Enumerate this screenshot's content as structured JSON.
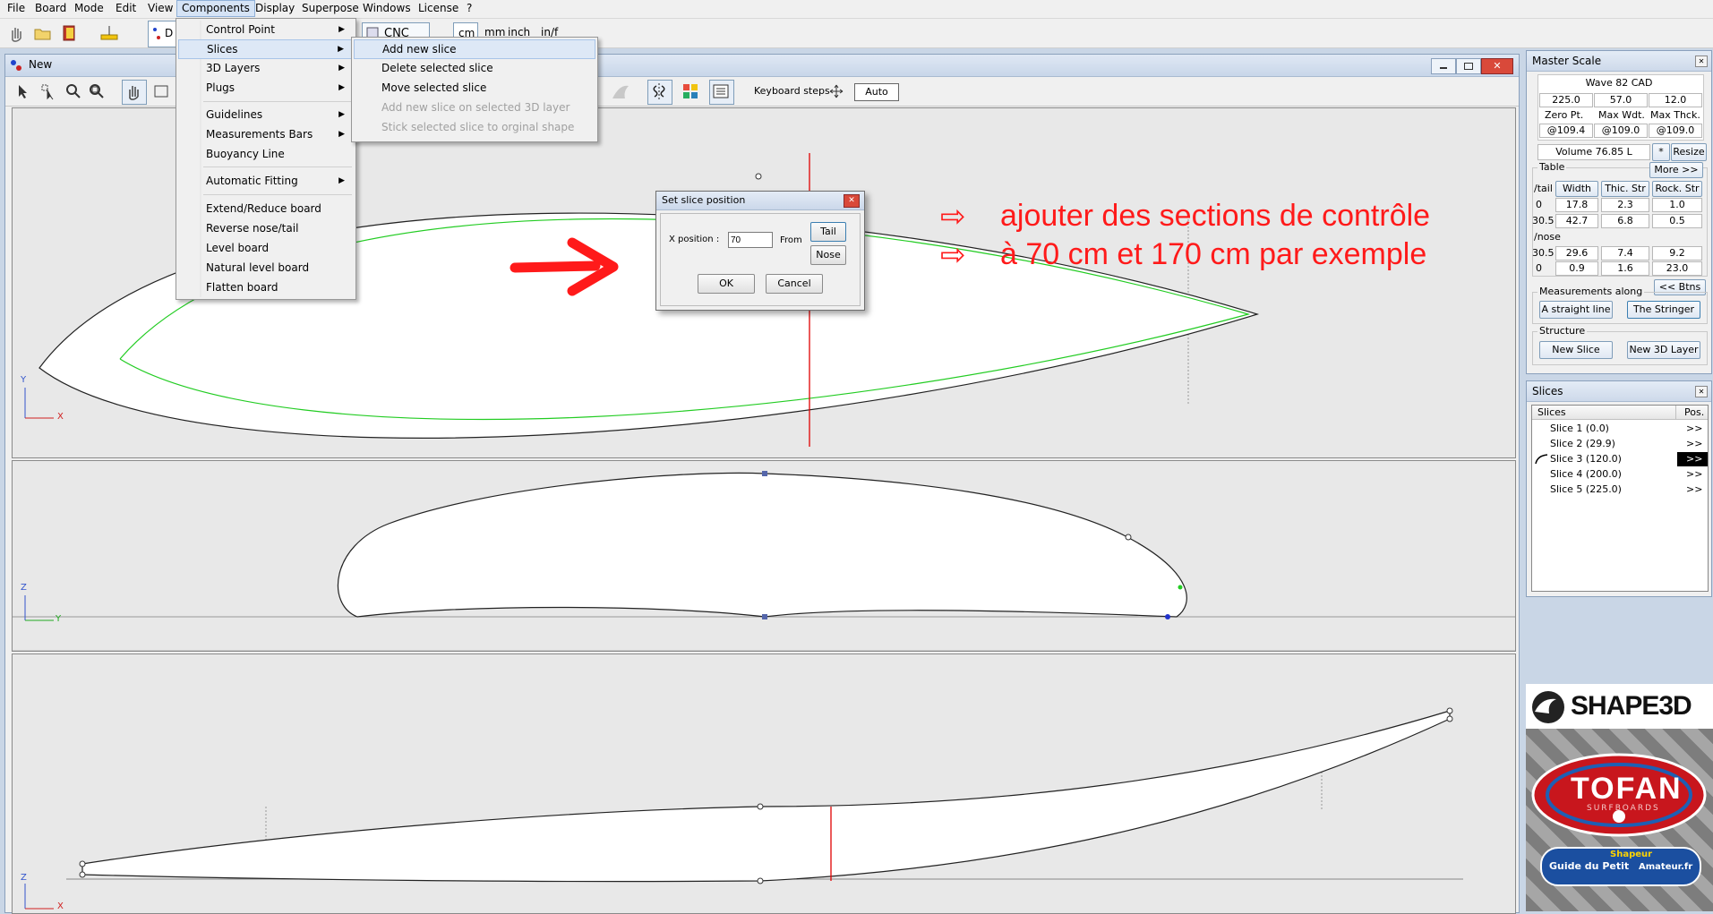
{
  "menubar": {
    "items": [
      "File",
      "Board",
      "Mode",
      "Edit",
      "View",
      "Components",
      "Display",
      "Superpose",
      "Windows",
      "License",
      "?"
    ]
  },
  "toolbar": {
    "cnc_label": "CNC",
    "units": [
      "cm",
      "mm",
      "inch",
      "in/f"
    ],
    "partial_label": "D"
  },
  "window": {
    "title": "New",
    "keyboard_steps_label": "Keyboard steps",
    "keyboard_steps_value": "Auto"
  },
  "components_menu": {
    "items": [
      {
        "label": "Control Point",
        "submenu": true
      },
      {
        "label": "Slices",
        "submenu": true,
        "highlighted": true
      },
      {
        "label": "3D Layers",
        "submenu": true
      },
      {
        "label": "Plugs",
        "submenu": true
      },
      {
        "label": "Guidelines",
        "submenu": true
      },
      {
        "label": "Measurements Bars",
        "submenu": true
      },
      {
        "label": "Buoyancy Line",
        "submenu": false
      },
      {
        "label": "Automatic Fitting",
        "submenu": true
      },
      {
        "label": "Extend/Reduce board",
        "submenu": false
      },
      {
        "label": "Reverse nose/tail",
        "submenu": false
      },
      {
        "label": "Level board",
        "submenu": false
      },
      {
        "label": "Natural level board",
        "submenu": false
      },
      {
        "label": "Flatten board",
        "submenu": false
      }
    ]
  },
  "slices_menu": {
    "items": [
      {
        "label": "Add new slice",
        "enabled": true,
        "highlighted": true
      },
      {
        "label": "Delete selected slice",
        "enabled": true
      },
      {
        "label": "Move selected slice",
        "enabled": true
      },
      {
        "label": "Add new slice on selected 3D layer",
        "enabled": false
      },
      {
        "label": "Stick selected slice to orginal shape",
        "enabled": false
      }
    ]
  },
  "dialog": {
    "title": "Set slice position",
    "x_position_label": "X position :",
    "x_position_value": "70",
    "from_label": "From",
    "tail_button": "Tail",
    "nose_button": "Nose",
    "ok_button": "OK",
    "cancel_button": "Cancel"
  },
  "annotation": {
    "line1": "ajouter des sections de contrôle",
    "line2": "à 70 cm et 170 cm par exemple",
    "arrow_glyph": "⇨",
    "color": "#ff1a1a"
  },
  "axes": {
    "top": {
      "vertical": "Y",
      "horizontal": "X"
    },
    "middle": {
      "vertical": "Z",
      "horizontal": "Y"
    },
    "bottom": {
      "vertical": "Z",
      "horizontal": "X"
    }
  },
  "master_scale": {
    "title": "Master Scale",
    "board_name": "Wave 82 CAD",
    "dims": [
      "225.0",
      "57.0",
      "12.0"
    ],
    "dim_labels": [
      "Zero Pt.",
      "Max Wdt.",
      "Max Thck."
    ],
    "dim_positions": [
      "@109.4",
      "@109.0",
      "@109.0"
    ],
    "volume": "Volume 76.85 L",
    "star_button": "*",
    "resize_button": "Resize",
    "more_button": "More >>",
    "table_label": "Table",
    "table_headers": [
      "Width",
      "Thic. Str",
      "Rock. Str"
    ],
    "tail_label": "/tail",
    "nose_label": "/nose",
    "tail_rows": [
      {
        "pos": "0",
        "values": [
          "17.8",
          "2.3",
          "1.0"
        ]
      },
      {
        "pos": "30.5",
        "values": [
          "42.7",
          "6.8",
          "0.5"
        ]
      }
    ],
    "nose_rows": [
      {
        "pos": "30.5",
        "values": [
          "29.6",
          "7.4",
          "9.2"
        ]
      },
      {
        "pos": "0",
        "values": [
          "0.9",
          "1.6",
          "23.0"
        ]
      }
    ],
    "btns_button": "<< Btns",
    "measurements_label": "Measurements along",
    "straight_line_button": "A straight line",
    "stringer_button": "The Stringer",
    "structure_label": "Structure",
    "new_slice_button": "New Slice",
    "new_3d_layer_button": "New 3D Layer"
  },
  "slices_panel": {
    "title": "Slices",
    "col_slices": "Slices",
    "col_pos": "Pos.",
    "items": [
      {
        "label": "Slice 1 (0.0)",
        "pos": ">>",
        "selected": false
      },
      {
        "label": "Slice 2 (29.9)",
        "pos": ">>",
        "selected": false
      },
      {
        "label": "Slice 3 (120.0)",
        "pos": ">>",
        "selected": true
      },
      {
        "label": "Slice 4 (200.0)",
        "pos": ">>",
        "selected": false
      },
      {
        "label": "Slice 5 (225.0)",
        "pos": ">>",
        "selected": false
      }
    ]
  },
  "logos": {
    "shape3d": "SHAPE3D",
    "tofan": "TOFAN",
    "tofan_sub": "SURFBOARDS",
    "guide_line1": "Guide du Petit",
    "guide_line2": "Shapeur",
    "guide_line3": "Amateur.fr"
  },
  "colors": {
    "outline_green": "#22cc22",
    "marker_red": "#e00000",
    "canvas_bg": "#e8e8e8",
    "board_fill": "#ffffff"
  }
}
